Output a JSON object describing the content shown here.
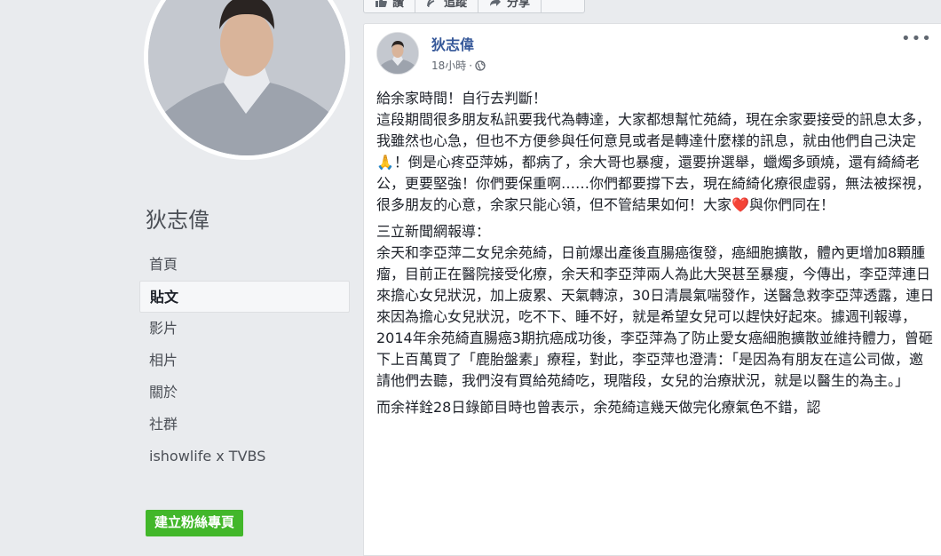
{
  "profile": {
    "name": "狄志偉"
  },
  "nav": {
    "items": [
      {
        "label": "首頁"
      },
      {
        "label": "貼文",
        "active": true
      },
      {
        "label": "影片"
      },
      {
        "label": "相片"
      },
      {
        "label": "關於"
      },
      {
        "label": "社群"
      },
      {
        "label": "ishowlife x TVBS"
      }
    ],
    "create_page_label": "建立粉絲專頁"
  },
  "action_bar": {
    "items": [
      {
        "label": "讚",
        "icon": "thumbs-up-icon"
      },
      {
        "label": "追蹤",
        "icon": "follow-icon"
      },
      {
        "label": "分享",
        "icon": "share-icon"
      },
      {
        "label": "",
        "icon": "more-icon"
      }
    ]
  },
  "post": {
    "author": "狄志偉",
    "time": "18小時",
    "time_separator": "·",
    "privacy_icon": "globe-icon",
    "more_label": "•••",
    "paragraph1": {
      "line1": "給余家時間！自行去判斷！",
      "body_before_heart": "這段期間很多朋友私訊要我代為轉達，大家都想幫忙苑綺，現在余家要接受的訊息太多，我雖然也心急，但也不方便參與任何意見或者是轉達什麼樣的訊息，就由他們自己決定🙏！倒是心疼亞萍姊，都病了，余大哥也暴瘦，還要拚選舉，蠟燭多頭燒，還有綺綺老公，更要堅強！你們要保重啊……你們都要撐下去，現在綺綺化療很虛弱，無法被探視，很多朋友的心意，余家只能心領，但不管結果如何！大家",
      "heart": "❤️",
      "body_after_heart": "與你們同在！"
    },
    "paragraph2": {
      "heading": "三立新聞網報導：",
      "body": "余天和李亞萍二女兒余苑綺，日前爆出產後直腸癌復發，癌細胞擴散，體內更增加8顆腫瘤，目前正在醫院接受化療，余天和李亞萍兩人為此大哭甚至暴瘦，今傳出，李亞萍連日來擔心女兒狀況，加上疲累、天氣轉涼，30日清晨氣喘發作，送醫急救李亞萍透露，連日來因為擔心女兒狀況，吃不下、睡不好，就是希望女兒可以趕快好起來。據週刊報導，2014年余苑綺直腸癌3期抗癌成功後，李亞萍為了防止愛女癌細胞擴散並維持體力，曾砸下上百萬買了「鹿胎盤素」療程，對此，李亞萍也澄清：「是因為有朋友在這公司做，邀請他們去聽，我們沒有買給苑綺吃，現階段，女兒的治療狀況，就是以醫生的為主。」"
    },
    "paragraph3": {
      "body": "而余祥銓28日錄節目時也曾表示，余苑綺這幾天做完化療氣色不錯，認"
    }
  },
  "colors": {
    "link": "#365899",
    "accent_green": "#42b72a",
    "background": "#e9ebee"
  }
}
